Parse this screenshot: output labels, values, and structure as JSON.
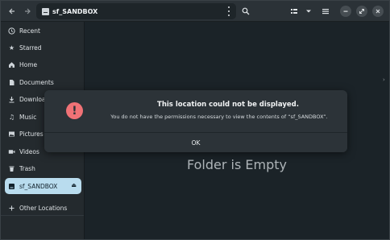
{
  "headerbar": {
    "path_label": "sf_SANDBOX",
    "back_icon": "arrow-left-icon",
    "forward_icon": "arrow-right-icon"
  },
  "sidebar": {
    "items": [
      {
        "label": "Recent",
        "icon": "clock-icon"
      },
      {
        "label": "Starred",
        "icon": "star-icon"
      },
      {
        "label": "Home",
        "icon": "home-icon"
      },
      {
        "label": "Documents",
        "icon": "document-icon"
      },
      {
        "label": "Downloads",
        "icon": "download-icon"
      },
      {
        "label": "Music",
        "icon": "music-icon"
      },
      {
        "label": "Pictures",
        "icon": "picture-icon"
      },
      {
        "label": "Videos",
        "icon": "video-icon"
      },
      {
        "label": "Trash",
        "icon": "trash-icon"
      },
      {
        "label": "sf_SANDBOX",
        "icon": "drive-icon",
        "active": true
      },
      {
        "label": "Other Locations",
        "icon": "plus-icon"
      }
    ]
  },
  "content": {
    "empty_text": "Folder is Empty"
  },
  "dialog": {
    "title": "This location could not be displayed.",
    "message": "You do not have the permissions necessary to view the contents of “sf_SANDBOX”.",
    "ok_label": "OK"
  },
  "colors": {
    "accent_active": "#b9dcee",
    "error_icon": "#f07276"
  }
}
